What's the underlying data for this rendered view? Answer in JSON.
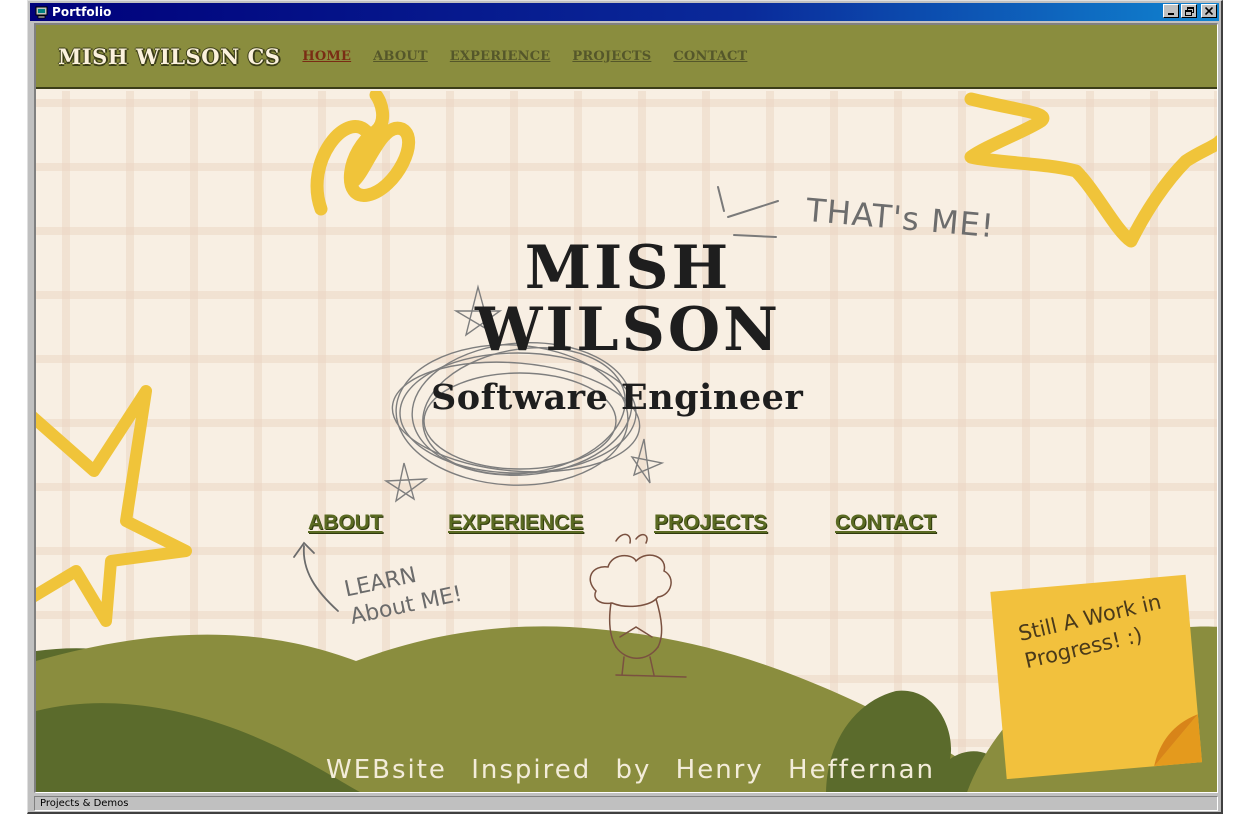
{
  "window": {
    "title": "Portfolio",
    "controls": {
      "minimize": "_",
      "maximize": "□",
      "close": "✕"
    }
  },
  "nav": {
    "brand": "MISH WILSON CS",
    "links": [
      {
        "label": "HOME",
        "active": true
      },
      {
        "label": "ABOUT",
        "active": false
      },
      {
        "label": "EXPERIENCE",
        "active": false
      },
      {
        "label": "PROJECTS",
        "active": false
      },
      {
        "label": "CONTACT",
        "active": false
      }
    ]
  },
  "hero": {
    "name_line1": "MISH",
    "name_line2": "WILSON",
    "subtitle": "Software Engineer",
    "thats_me": "THAT's ME!",
    "learn_note_line1": "LEARN",
    "learn_note_line2": "About ME!",
    "links": [
      "ABOUT",
      "EXPERIENCE",
      "PROJECTS",
      "CONTACT"
    ],
    "sticky_note": "Still A Work in Progress! :)",
    "credit": "WEBsite Inspired by Henry Heffernan"
  },
  "statusbar": {
    "text": "Projects & Demos"
  },
  "colors": {
    "nav_bg": "#8a8d3e",
    "page_bg": "#f8efe3",
    "accent_yellow": "#f0c43a",
    "hill_green": "#8a8d3e",
    "hill_dark": "#5f6a2a",
    "link_green": "#5a6a22",
    "title_blue": "#00007b"
  }
}
